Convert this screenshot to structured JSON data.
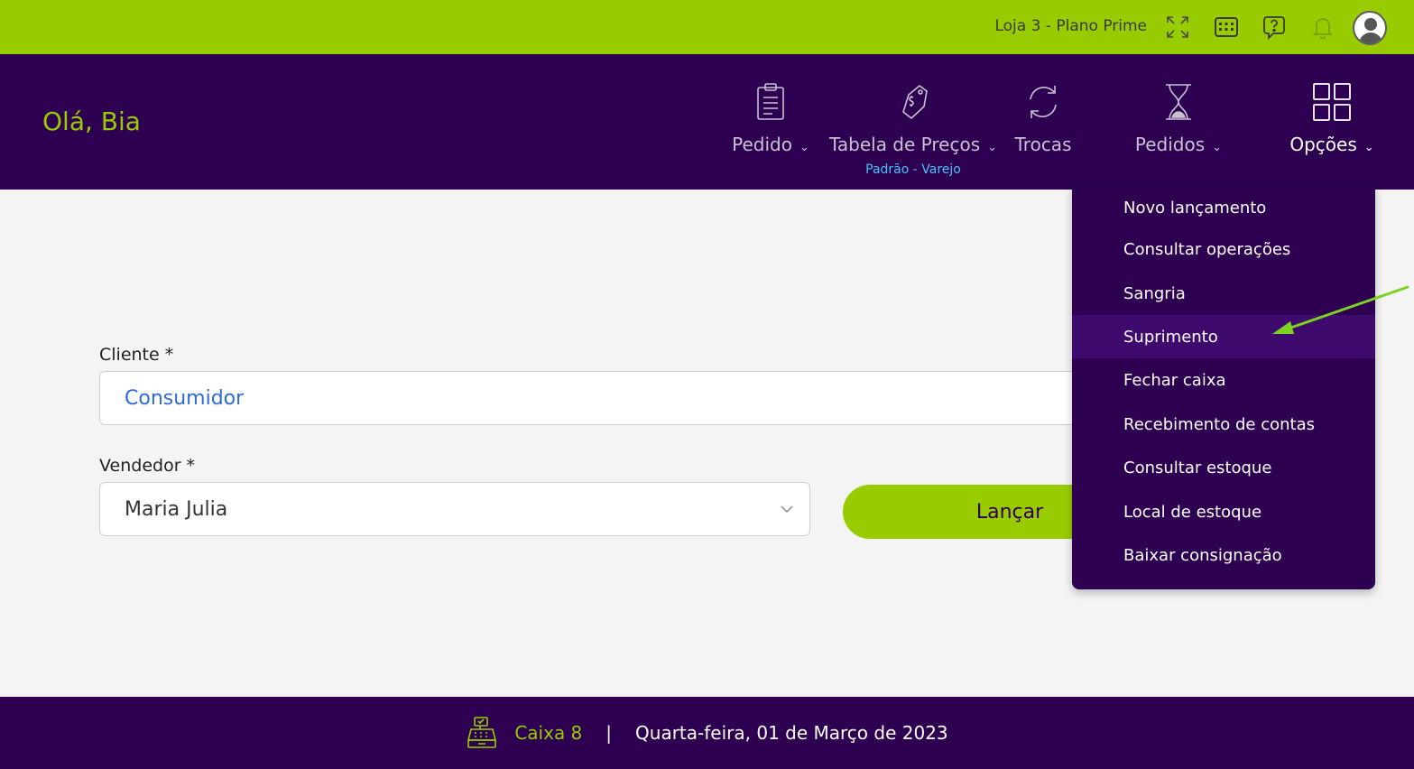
{
  "topbar": {
    "store_label": "Loja 3 - Plano Prime",
    "icons": [
      "fullscreen-icon",
      "keyboard-icon",
      "help-chat-icon",
      "bell-icon",
      "user-avatar"
    ]
  },
  "header": {
    "greeting": "Olá, Bia",
    "nav": [
      {
        "label": "Pedido",
        "icon": "clipboard-icon",
        "has_chevron": true
      },
      {
        "label": "Tabela de Preços",
        "icon": "price-tag-icon",
        "has_chevron": true,
        "sub": "Padrão - Varejo"
      },
      {
        "label": "Trocas",
        "icon": "exchange-icon",
        "has_chevron": false
      },
      {
        "label": "Pedidos",
        "icon": "hourglass-icon",
        "has_chevron": true
      },
      {
        "label": "Opções",
        "icon": "grid-icon",
        "has_chevron": true
      }
    ]
  },
  "form": {
    "client_label": "Cliente *",
    "client_value": "Consumidor",
    "seller_label": "Vendedor *",
    "seller_value": "Maria Julia",
    "launch_button": "Lançar"
  },
  "options_menu": {
    "items": [
      "Novo lançamento",
      "Consultar operações",
      "Sangria",
      "Suprimento",
      "Fechar caixa",
      "Recebimento de contas",
      "Consultar estoque",
      "Local de estoque",
      "Baixar consignação"
    ],
    "highlighted": "Suprimento"
  },
  "footer": {
    "register": "Caixa 8",
    "separator": "|",
    "date": "Quarta-feira, 01 de Março de 2023"
  },
  "colors": {
    "brand_green": "#99cc00",
    "brand_purple": "#2d0052",
    "link_blue": "#2f6bd6",
    "subtitle_cyan": "#4fc3f7"
  }
}
